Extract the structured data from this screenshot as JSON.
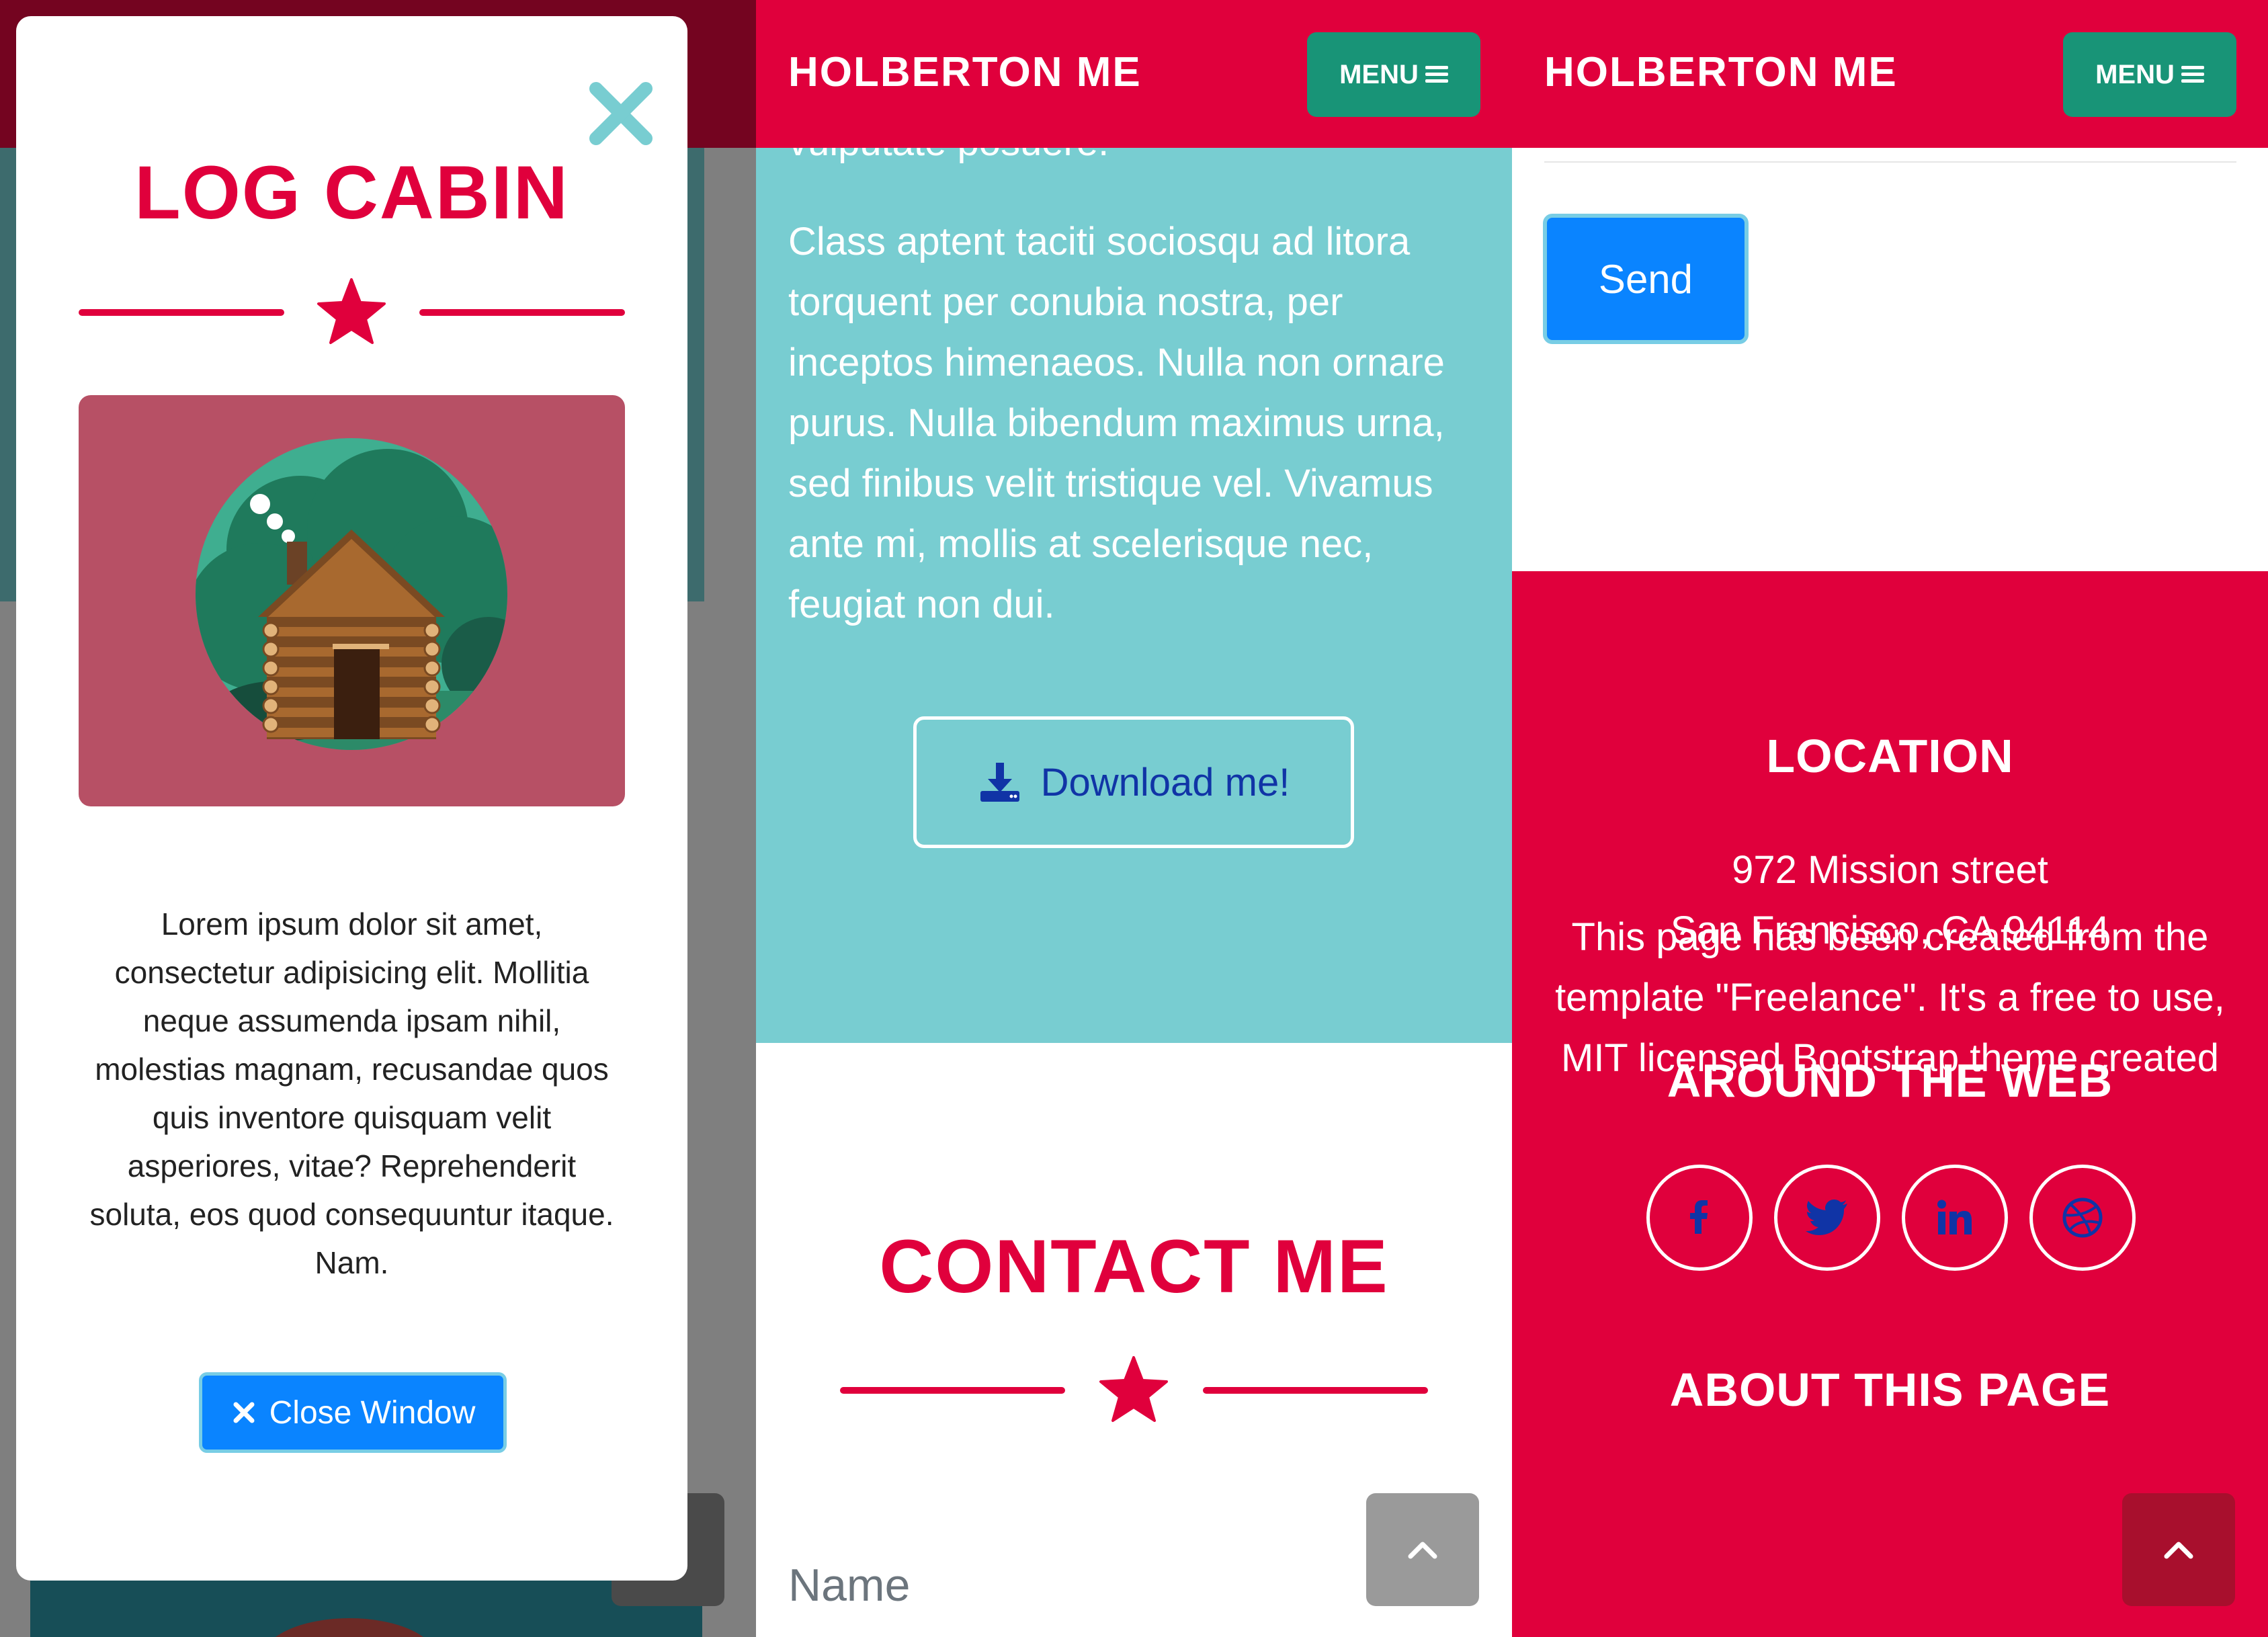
{
  "colors": {
    "primary": "#e0003c",
    "teal": "#189477",
    "about_bg": "#78cdd1",
    "button_blue": "#0a84ff",
    "modal_image_bg": "#b75065"
  },
  "modal": {
    "title": "LOG CABIN",
    "close_icon": "close-x-icon",
    "divider_icon": "star-icon",
    "image": "log-cabin-illustration",
    "description": "Lorem ipsum dolor sit amet, consectetur adipisicing elit. Mollitia neque assumenda ipsam nihil, molestias magnam, recusandae quos quis inventore quisquam velit asperiores, vitae? Reprehenderit soluta, eos quod consequuntur itaque. Nam.",
    "close_button_label": "Close Window",
    "close_button_icon": "times-icon"
  },
  "navbar": {
    "brand": "HOLBERTON ME",
    "menu_label": "MENU",
    "menu_icon": "bars-icon"
  },
  "about": {
    "clipped_text": "vulputate posuere.",
    "paragraph": "Class aptent taciti sociosqu ad litora torquent per conubia nostra, per inceptos himenaeos. Nulla non ornare purus. Nulla bibendum maximus urna, sed finibus velit tristique vel. Vivamus ante mi, mollis at scelerisque nec, feugiat non dui.",
    "download_label": "Download me!",
    "download_icon": "download-icon"
  },
  "contact": {
    "title": "CONTACT ME",
    "name_label": "Name",
    "send_label": "Send"
  },
  "footer": {
    "location_heading": "LOCATION",
    "address_line1": "972 Mission street",
    "address_line2": "San Francisco, CA 94114",
    "web_heading": "AROUND THE WEB",
    "social_icons": [
      "facebook-icon",
      "twitter-icon",
      "linkedin-icon",
      "dribbble-icon"
    ],
    "about_heading": "ABOUT THIS PAGE",
    "about_text": "This page has been created from the template \"Freelance\". It's a free to use, MIT licensed Bootstrap theme created"
  },
  "scroll_top_icon": "chevron-up-icon"
}
